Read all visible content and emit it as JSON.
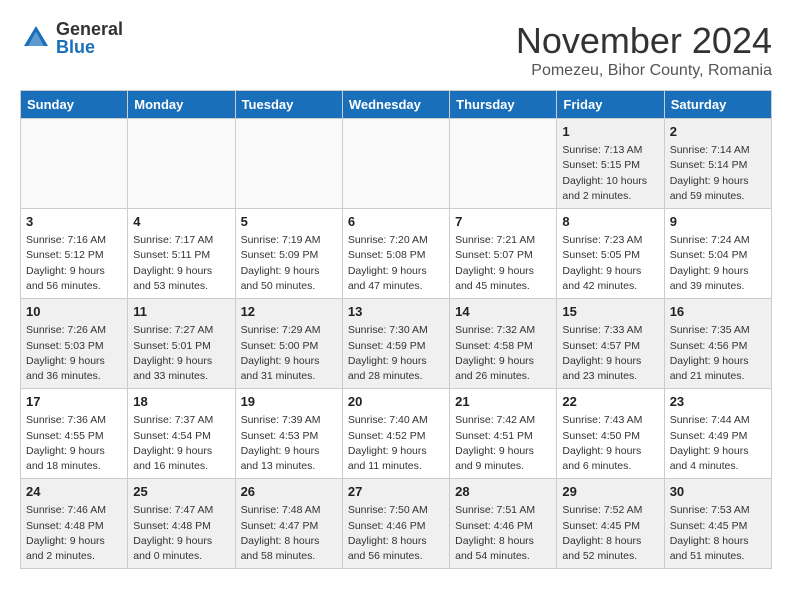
{
  "logo": {
    "general": "General",
    "blue": "Blue"
  },
  "header": {
    "month": "November 2024",
    "location": "Pomezeu, Bihor County, Romania"
  },
  "days_of_week": [
    "Sunday",
    "Monday",
    "Tuesday",
    "Wednesday",
    "Thursday",
    "Friday",
    "Saturday"
  ],
  "weeks": [
    [
      {
        "num": "",
        "info": ""
      },
      {
        "num": "",
        "info": ""
      },
      {
        "num": "",
        "info": ""
      },
      {
        "num": "",
        "info": ""
      },
      {
        "num": "",
        "info": ""
      },
      {
        "num": "1",
        "info": "Sunrise: 7:13 AM\nSunset: 5:15 PM\nDaylight: 10 hours and 2 minutes."
      },
      {
        "num": "2",
        "info": "Sunrise: 7:14 AM\nSunset: 5:14 PM\nDaylight: 9 hours and 59 minutes."
      }
    ],
    [
      {
        "num": "3",
        "info": "Sunrise: 7:16 AM\nSunset: 5:12 PM\nDaylight: 9 hours and 56 minutes."
      },
      {
        "num": "4",
        "info": "Sunrise: 7:17 AM\nSunset: 5:11 PM\nDaylight: 9 hours and 53 minutes."
      },
      {
        "num": "5",
        "info": "Sunrise: 7:19 AM\nSunset: 5:09 PM\nDaylight: 9 hours and 50 minutes."
      },
      {
        "num": "6",
        "info": "Sunrise: 7:20 AM\nSunset: 5:08 PM\nDaylight: 9 hours and 47 minutes."
      },
      {
        "num": "7",
        "info": "Sunrise: 7:21 AM\nSunset: 5:07 PM\nDaylight: 9 hours and 45 minutes."
      },
      {
        "num": "8",
        "info": "Sunrise: 7:23 AM\nSunset: 5:05 PM\nDaylight: 9 hours and 42 minutes."
      },
      {
        "num": "9",
        "info": "Sunrise: 7:24 AM\nSunset: 5:04 PM\nDaylight: 9 hours and 39 minutes."
      }
    ],
    [
      {
        "num": "10",
        "info": "Sunrise: 7:26 AM\nSunset: 5:03 PM\nDaylight: 9 hours and 36 minutes."
      },
      {
        "num": "11",
        "info": "Sunrise: 7:27 AM\nSunset: 5:01 PM\nDaylight: 9 hours and 33 minutes."
      },
      {
        "num": "12",
        "info": "Sunrise: 7:29 AM\nSunset: 5:00 PM\nDaylight: 9 hours and 31 minutes."
      },
      {
        "num": "13",
        "info": "Sunrise: 7:30 AM\nSunset: 4:59 PM\nDaylight: 9 hours and 28 minutes."
      },
      {
        "num": "14",
        "info": "Sunrise: 7:32 AM\nSunset: 4:58 PM\nDaylight: 9 hours and 26 minutes."
      },
      {
        "num": "15",
        "info": "Sunrise: 7:33 AM\nSunset: 4:57 PM\nDaylight: 9 hours and 23 minutes."
      },
      {
        "num": "16",
        "info": "Sunrise: 7:35 AM\nSunset: 4:56 PM\nDaylight: 9 hours and 21 minutes."
      }
    ],
    [
      {
        "num": "17",
        "info": "Sunrise: 7:36 AM\nSunset: 4:55 PM\nDaylight: 9 hours and 18 minutes."
      },
      {
        "num": "18",
        "info": "Sunrise: 7:37 AM\nSunset: 4:54 PM\nDaylight: 9 hours and 16 minutes."
      },
      {
        "num": "19",
        "info": "Sunrise: 7:39 AM\nSunset: 4:53 PM\nDaylight: 9 hours and 13 minutes."
      },
      {
        "num": "20",
        "info": "Sunrise: 7:40 AM\nSunset: 4:52 PM\nDaylight: 9 hours and 11 minutes."
      },
      {
        "num": "21",
        "info": "Sunrise: 7:42 AM\nSunset: 4:51 PM\nDaylight: 9 hours and 9 minutes."
      },
      {
        "num": "22",
        "info": "Sunrise: 7:43 AM\nSunset: 4:50 PM\nDaylight: 9 hours and 6 minutes."
      },
      {
        "num": "23",
        "info": "Sunrise: 7:44 AM\nSunset: 4:49 PM\nDaylight: 9 hours and 4 minutes."
      }
    ],
    [
      {
        "num": "24",
        "info": "Sunrise: 7:46 AM\nSunset: 4:48 PM\nDaylight: 9 hours and 2 minutes."
      },
      {
        "num": "25",
        "info": "Sunrise: 7:47 AM\nSunset: 4:48 PM\nDaylight: 9 hours and 0 minutes."
      },
      {
        "num": "26",
        "info": "Sunrise: 7:48 AM\nSunset: 4:47 PM\nDaylight: 8 hours and 58 minutes."
      },
      {
        "num": "27",
        "info": "Sunrise: 7:50 AM\nSunset: 4:46 PM\nDaylight: 8 hours and 56 minutes."
      },
      {
        "num": "28",
        "info": "Sunrise: 7:51 AM\nSunset: 4:46 PM\nDaylight: 8 hours and 54 minutes."
      },
      {
        "num": "29",
        "info": "Sunrise: 7:52 AM\nSunset: 4:45 PM\nDaylight: 8 hours and 52 minutes."
      },
      {
        "num": "30",
        "info": "Sunrise: 7:53 AM\nSunset: 4:45 PM\nDaylight: 8 hours and 51 minutes."
      }
    ]
  ]
}
